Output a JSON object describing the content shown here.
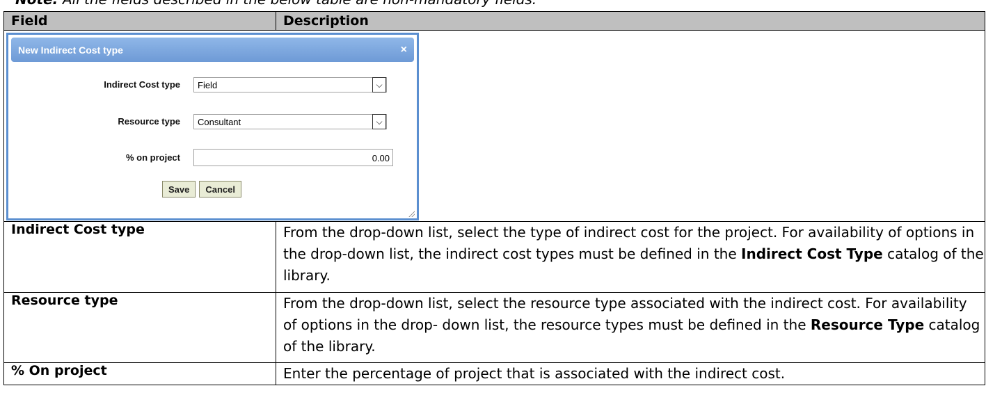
{
  "note": {
    "label": "Note:",
    "text": " All the fields described in the below table are non-mandatory fields."
  },
  "table": {
    "header": {
      "field": "Field",
      "description": "Description"
    },
    "rows": [
      {
        "field": "Indirect Cost type",
        "desc_pre": "From the drop-down list, select the type of indirect cost for  the project. For availability of options in the drop-down list,  the indirect cost types must be  defined in the ",
        "desc_bold": "Indirect Cost  Type",
        "desc_post": " catalog of the library."
      },
      {
        "field": "Resource type",
        "desc_pre": "From the drop-down list, select the resource type associated with the indirect  cost. For availability of options in the drop- down list, the resource types must be  defined in the ",
        "desc_bold": "Resource Type",
        "desc_post": " catalog of the library."
      },
      {
        "field": "% On project",
        "desc_pre": "Enter the percentage of project that is associated with the indirect cost.",
        "desc_bold": "",
        "desc_post": ""
      }
    ]
  },
  "dialog": {
    "title": "New Indirect Cost type",
    "close_glyph": "×",
    "fields": {
      "indirect_cost_type": {
        "label": "Indirect Cost type",
        "value": "Field"
      },
      "resource_type": {
        "label": "Resource type",
        "value": "Consultant"
      },
      "percent_on_project": {
        "label": "% on project",
        "value": "0.00"
      }
    },
    "save_label": "Save",
    "cancel_label": "Cancel",
    "arrow_glyph": "⌵"
  },
  "colors": {
    "header_bg": "#bfbfbf",
    "dialog_border": "#5b8fd0",
    "button_bg": "#e9ecd6"
  }
}
